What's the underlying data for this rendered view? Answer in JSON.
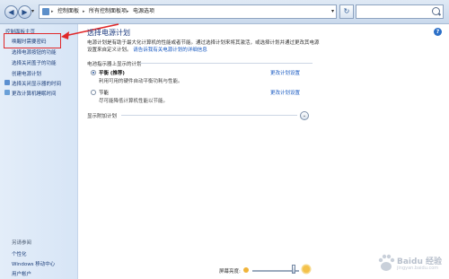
{
  "address_bar": {
    "crumbs": [
      "控制面板",
      "所有控制面板项",
      "电源选项"
    ],
    "search_placeholder": ""
  },
  "sidebar": {
    "items": [
      {
        "label": "控制面板主页"
      },
      {
        "label": "唤醒时需要密码"
      },
      {
        "label": "选择电源按钮的功能"
      },
      {
        "label": "选择关闭盖子的功能"
      },
      {
        "label": "创建电源计划"
      },
      {
        "label": "选择关闭显示器的时间"
      },
      {
        "label": "更改计算机睡眠时间"
      }
    ],
    "see_also_title": "另请参阅",
    "see_also": [
      "个性化",
      "Windows 移动中心",
      "用户帐户"
    ]
  },
  "main": {
    "title": "选择电源计划",
    "description": "电源计划是有助于最大化计算机的性能或者节能。通过选择计划来将其激活，或选择计划并通过更改其电源设置来自定义计划。",
    "description_link": "请告诉我有关电源计划的详细信息",
    "section1": "电池指示器上显示的计划",
    "plans": [
      {
        "name": "平衡 (推荐)",
        "desc": "利用可用的硬件自动平衡功耗与性能。",
        "link": "更改计划设置",
        "checked": true
      },
      {
        "name": "节能",
        "desc": "尽可能降低计算机性能以节能。",
        "link": "更改计划设置",
        "checked": false
      }
    ],
    "section2": "显示附加计划",
    "brightness_label": "屏幕亮度:",
    "brightness_level": 0.88
  },
  "watermark": {
    "text": "Baidu 经验",
    "sub": "jingyan.baidu.com"
  },
  "colors": {
    "highlight_red": "#e0282a",
    "link_blue": "#1a5bc2",
    "title_blue": "#1e3c80"
  }
}
